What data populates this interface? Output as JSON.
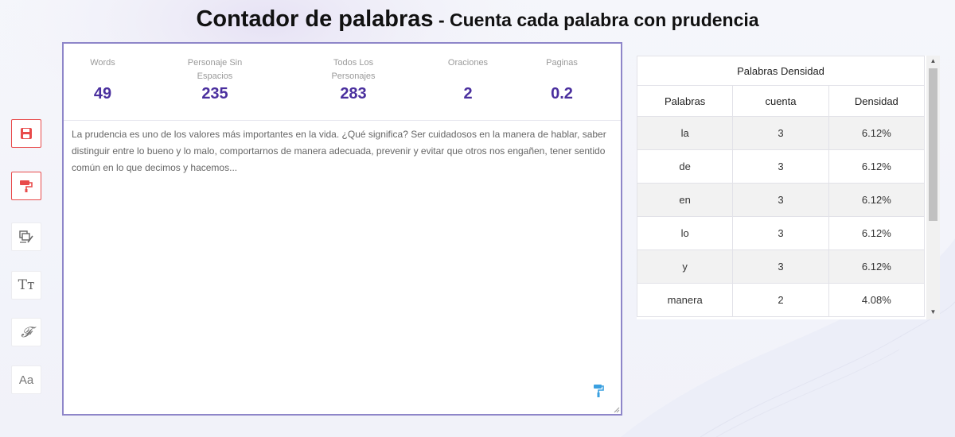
{
  "header": {
    "title_main": "Contador de palabras",
    "title_sub": " - Cuenta cada palabra con prudencia"
  },
  "toolbar": {
    "buttons": [
      {
        "icon": "save-icon",
        "color": "#e84b4b"
      },
      {
        "icon": "paint-roller-icon",
        "color": "#e84b4b"
      },
      {
        "icon": "copy-edit-icon",
        "color": "#666666"
      },
      {
        "icon": "text-size-icon",
        "color": "#666666"
      },
      {
        "icon": "font-style-icon",
        "color": "#666666"
      },
      {
        "icon": "letter-case-icon",
        "color": "#666666"
      }
    ],
    "text_size_label": "Tт",
    "font_style_label": "𝓕",
    "letter_case_label": "Aa"
  },
  "stats": [
    {
      "label": "Words",
      "value": "49"
    },
    {
      "label": "Personaje Sin Espacios",
      "value": "235"
    },
    {
      "label": "Todos Los Personajes",
      "value": "283"
    },
    {
      "label": "Oraciones",
      "value": "2"
    },
    {
      "label": "Paginas",
      "value": "0.2"
    }
  ],
  "editor": {
    "text": "La prudencia es uno de los valores más importantes en la vida. ¿Qué significa? Ser cuidadosos en la manera de hablar, saber distinguir entre lo bueno y lo malo, comportarnos de manera adecuada, prevenir y evitar que otros nos engañen, tener sentido común en lo que decimos y hacemos..."
  },
  "density": {
    "caption": "Palabras Densidad",
    "columns": [
      "Palabras",
      "cuenta",
      "Densidad"
    ],
    "rows": [
      [
        "la",
        "3",
        "6.12%"
      ],
      [
        "de",
        "3",
        "6.12%"
      ],
      [
        "en",
        "3",
        "6.12%"
      ],
      [
        "lo",
        "3",
        "6.12%"
      ],
      [
        "y",
        "3",
        "6.12%"
      ],
      [
        "manera",
        "2",
        "4.08%"
      ]
    ]
  },
  "colors": {
    "accent": "#4a2f9e",
    "editor_border": "#8e86c9",
    "red_icon": "#e84b4b"
  }
}
